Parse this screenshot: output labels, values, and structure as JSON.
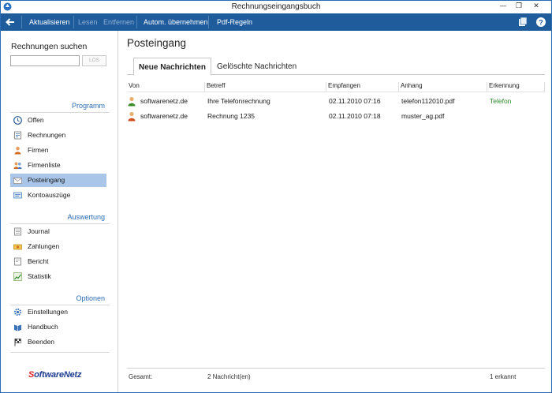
{
  "window": {
    "title": "Rechnungseingangsbuch"
  },
  "toolbar": {
    "items": [
      {
        "label": "Aktualisieren",
        "enabled": true
      },
      {
        "label": "Lesen",
        "enabled": false
      },
      {
        "label": "Entfernen",
        "enabled": false
      },
      {
        "label": "Autom. übernehmen",
        "enabled": true
      },
      {
        "label": "Pdf-Regeln",
        "enabled": true
      }
    ]
  },
  "sidebar": {
    "search": {
      "title": "Rechnungen suchen",
      "value": "",
      "button": "LOS"
    },
    "sections": {
      "programm": "Programm",
      "auswertung": "Auswertung",
      "optionen": "Optionen"
    },
    "programm_items": [
      {
        "label": "Offen",
        "icon": "clock-icon"
      },
      {
        "label": "Rechnungen",
        "icon": "invoice-icon"
      },
      {
        "label": "Firmen",
        "icon": "person-icon"
      },
      {
        "label": "Firmenliste",
        "icon": "people-icon"
      },
      {
        "label": "Posteingang",
        "icon": "envelope-icon",
        "active": true
      },
      {
        "label": "Kontoauszüge",
        "icon": "statement-icon"
      }
    ],
    "auswertung_items": [
      {
        "label": "Journal",
        "icon": "journal-icon"
      },
      {
        "label": "Zahlungen",
        "icon": "payments-icon"
      },
      {
        "label": "Bericht",
        "icon": "report-icon"
      },
      {
        "label": "Statistik",
        "icon": "chart-icon"
      }
    ],
    "optionen_items": [
      {
        "label": "Einstellungen",
        "icon": "gear-icon"
      },
      {
        "label": "Handbuch",
        "icon": "book-icon"
      },
      {
        "label": "Beenden",
        "icon": "flag-icon"
      }
    ],
    "logo": {
      "prefix": "S",
      "text": "oftwareNetz"
    }
  },
  "main": {
    "title": "Posteingang",
    "tabs": [
      {
        "label": "Neue Nachrichten",
        "active": true
      },
      {
        "label": "Gelöschte Nachrichten",
        "active": false
      }
    ],
    "columns": [
      "Von",
      "Betreff",
      "Empfangen",
      "Anhang",
      "Erkennung"
    ],
    "rows": [
      {
        "von": "softwarenetz.de",
        "betreff": "Ihre Telefonrechnung",
        "empfangen": "02.11.2010 07:16",
        "anhang": "telefon112010.pdf",
        "erkennung": "Telefon",
        "sender_color": "#3a8a2a"
      },
      {
        "von": "softwarenetz.de",
        "betreff": "Rechnung 1235",
        "empfangen": "02.11.2010 07:18",
        "anhang": "muster_ag.pdf",
        "erkennung": "",
        "sender_color": "#d14f1e"
      }
    ],
    "status": {
      "label": "Gesamt:",
      "count": "2 Nachricht(en)",
      "recognized": "1 erkannt"
    }
  },
  "colors": {
    "accent": "#1e5c9c",
    "active_nav": "#a9c6e8",
    "section_heading": "#2d6bb3",
    "recognized": "#2a8a2a"
  }
}
